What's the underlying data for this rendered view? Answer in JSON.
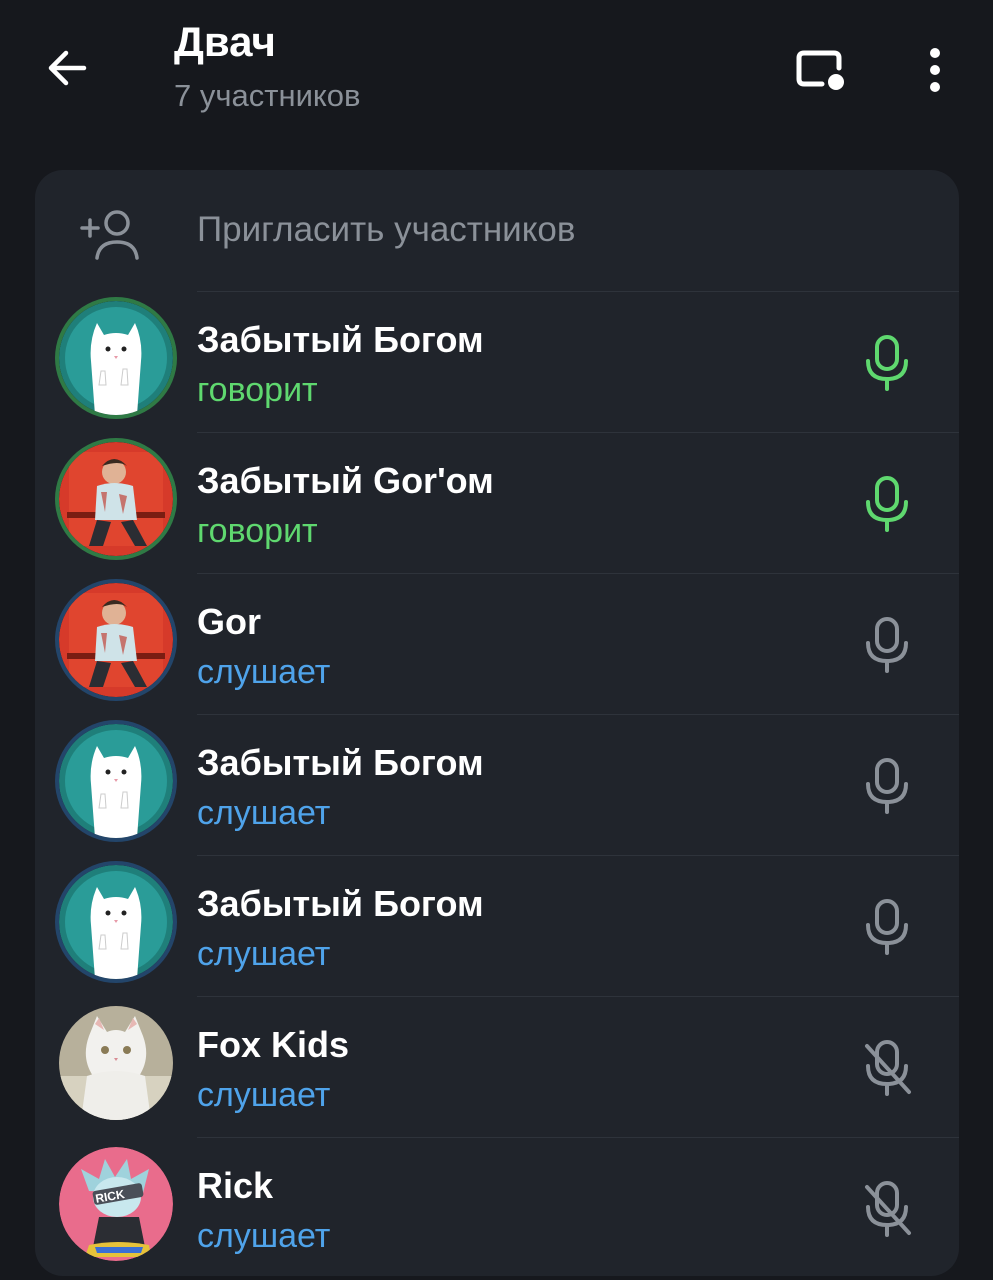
{
  "header": {
    "title": "Двач",
    "subtitle": "7 участников",
    "icons": {
      "back": "arrow-left-icon",
      "screen": "screencast-icon",
      "more": "more-vertical-icon"
    }
  },
  "invite": {
    "label": "Пригласить участников",
    "icon": "add-user-icon"
  },
  "colors": {
    "speaking": "#5fd86f",
    "listening": "#4fa3ea",
    "mic_idle": "#8b9199",
    "panel": "#20242b",
    "background": "#16181d"
  },
  "participants": [
    {
      "name": "Забытый Богом",
      "status": "говорит",
      "state": "speaking",
      "avatar": "white-cat-avatar",
      "mic": "mic-icon"
    },
    {
      "name": "Забытый Gor'ом",
      "status": "говорит",
      "state": "speaking",
      "avatar": "photo-avatar",
      "mic": "mic-icon"
    },
    {
      "name": "Gor",
      "status": "слушает",
      "state": "listening",
      "avatar": "photo-avatar",
      "mic": "mic-icon"
    },
    {
      "name": "Забытый Богом",
      "status": "слушает",
      "state": "listening",
      "avatar": "white-cat-avatar",
      "mic": "mic-icon"
    },
    {
      "name": "Забытый Богом",
      "status": "слушает",
      "state": "listening",
      "avatar": "white-cat-avatar",
      "mic": "mic-icon"
    },
    {
      "name": "Fox Kids",
      "status": "слушает",
      "state": "listening",
      "avatar": "kitten-photo-avatar",
      "mic": "mic-muted-icon"
    },
    {
      "name": "Rick",
      "status": "слушает",
      "state": "listening",
      "avatar": "rick-avatar",
      "mic": "mic-muted-icon"
    }
  ]
}
